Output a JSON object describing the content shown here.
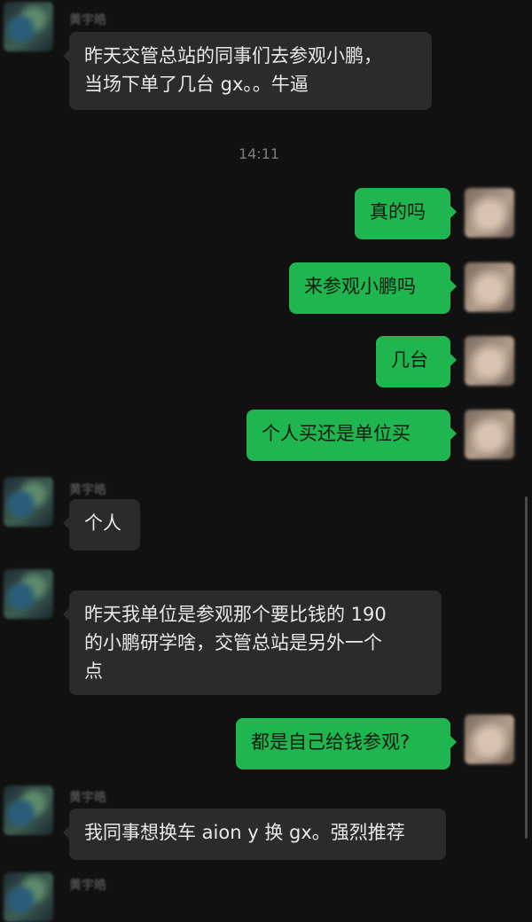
{
  "chat": {
    "timestamp": "14:11",
    "messages": [
      {
        "direction": "in",
        "sender": "黄宇皓",
        "text": "昨天交管总站的同事们去参观小鹏，\n当场下单了几台 gx。。牛逼"
      },
      {
        "direction": "out",
        "text": "真的吗"
      },
      {
        "direction": "out",
        "text": "来参观小鹏吗"
      },
      {
        "direction": "out",
        "text": "几台"
      },
      {
        "direction": "out",
        "text": "个人买还是单位买"
      },
      {
        "direction": "in",
        "sender": "黄宇皓",
        "text": "个人"
      },
      {
        "direction": "in",
        "sender": "",
        "text": "昨天我单位是参观那个要比钱的 190\n的小鹏研学啥，交管总站是另外一个\n点"
      },
      {
        "direction": "out",
        "text": "都是自己给钱参观?"
      },
      {
        "direction": "in",
        "sender": "黄宇皓",
        "text": "我同事想换车 aion y 换 gx。强烈推荐"
      },
      {
        "direction": "in",
        "sender": "黄宇皓",
        "text": ""
      }
    ]
  }
}
